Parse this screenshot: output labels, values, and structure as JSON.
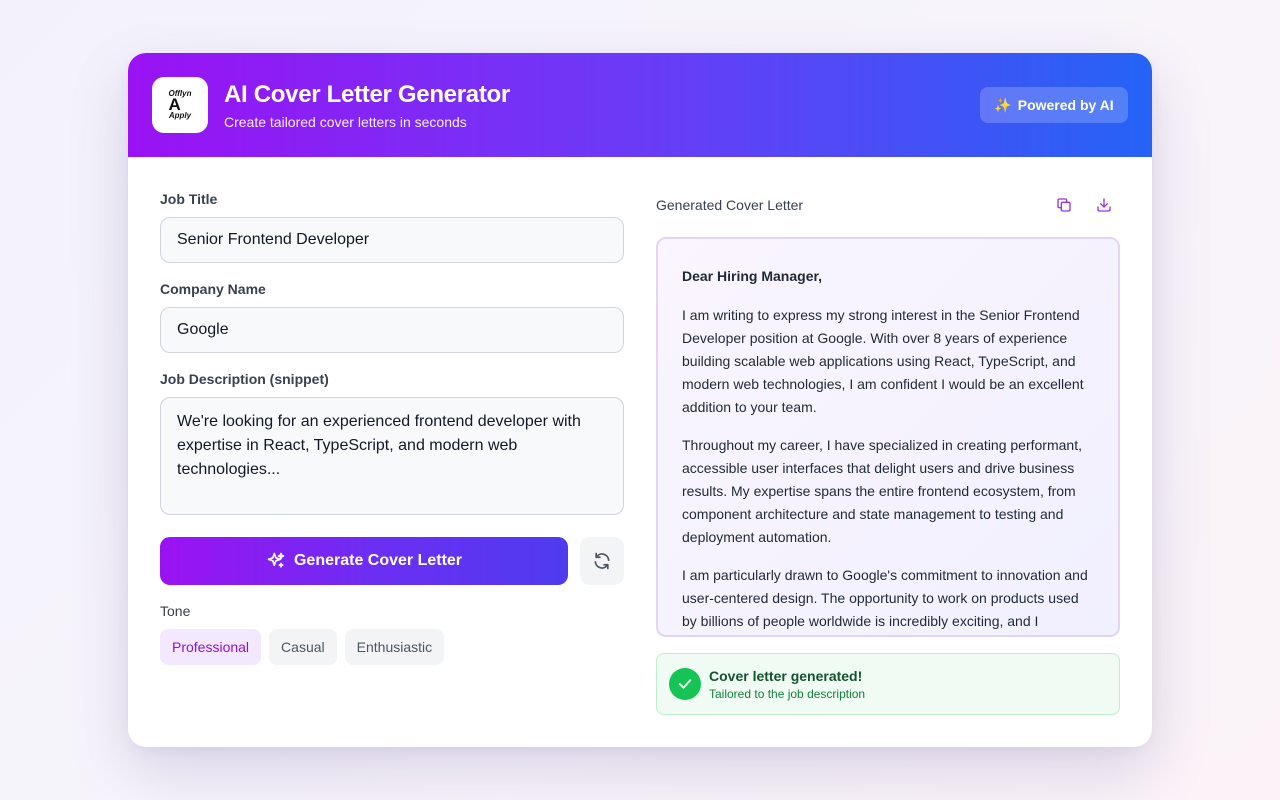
{
  "header": {
    "logo_top": "Offlyn",
    "logo_letter": "A",
    "logo_bottom": "Apply",
    "title": "AI Cover Letter Generator",
    "subtitle": "Create tailored cover letters in seconds",
    "badge_icon": "sparkles-emoji",
    "badge_emoji": "✨",
    "badge_label": "Powered by AI"
  },
  "form": {
    "job_title_label": "Job Title",
    "job_title_value": "Senior Frontend Developer",
    "company_label": "Company Name",
    "company_value": "Google",
    "description_label": "Job Description (snippet)",
    "description_value": "We're looking for an experienced frontend developer with expertise in React, TypeScript, and modern web technologies...",
    "generate_label": "Generate Cover Letter",
    "tone_label": "Tone",
    "tones": [
      "Professional",
      "Casual",
      "Enthusiastic"
    ],
    "selected_tone": "Professional"
  },
  "output": {
    "label": "Generated Cover Letter",
    "salutation": "Dear Hiring Manager,",
    "paragraphs": [
      "I am writing to express my strong interest in the Senior Frontend Developer position at Google. With over 8 years of experience building scalable web applications using React, TypeScript, and modern web technologies, I am confident I would be an excellent addition to your team.",
      "Throughout my career, I have specialized in creating performant, accessible user interfaces that delight users and drive business results. My expertise spans the entire frontend ecosystem, from component architecture and state management to testing and deployment automation.",
      "I am particularly drawn to Google's commitment to innovation and user-centered design. The opportunity to work on products used by billions of people worldwide is incredibly exciting, and I"
    ]
  },
  "status": {
    "title": "Cover letter generated!",
    "subtitle": "Tailored to the job description"
  },
  "colors": {
    "accent": "#9b12f2",
    "brand_blue": "#2563f6",
    "success": "#16c455"
  }
}
